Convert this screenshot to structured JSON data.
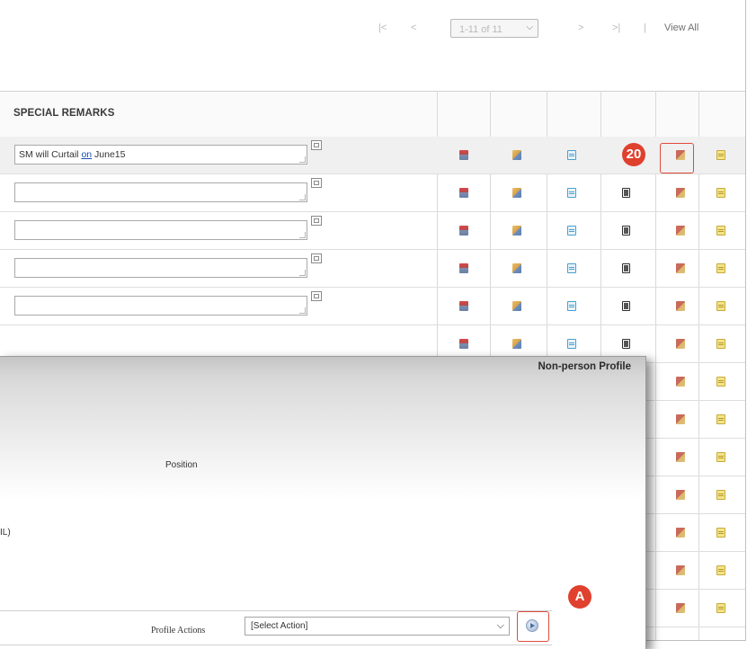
{
  "pager": {
    "first": "|<",
    "prev": "<",
    "range": "1-11 of 11",
    "next": ">",
    "last": ">|",
    "separator": "|",
    "view_all": "View All"
  },
  "grid": {
    "special_remarks_header": "SPECIAL REMARKS",
    "rows": [
      {
        "remark_prefix": "SM will Curtail ",
        "remark_link": "on",
        "remark_suffix": " June15"
      },
      {
        "remark_prefix": "",
        "remark_link": "",
        "remark_suffix": ""
      },
      {
        "remark_prefix": "",
        "remark_link": "",
        "remark_suffix": ""
      },
      {
        "remark_prefix": "",
        "remark_link": "",
        "remark_suffix": ""
      },
      {
        "remark_prefix": "",
        "remark_link": "",
        "remark_suffix": ""
      }
    ],
    "row_icons": [
      "document-red-icon",
      "document-transfer-icon",
      "form-blue-icon",
      "copy-black-icon",
      "document-stack-icon",
      "note-yellow-icon"
    ]
  },
  "callouts": {
    "step_number": "20",
    "step_letter": "A",
    "color": "#e0402e"
  },
  "profile": {
    "title": "Non-person Profile",
    "position_label": "Position",
    "mil_label": "IL)",
    "actions_label": "Profile Actions",
    "action_select_value": "[Select Action]"
  }
}
